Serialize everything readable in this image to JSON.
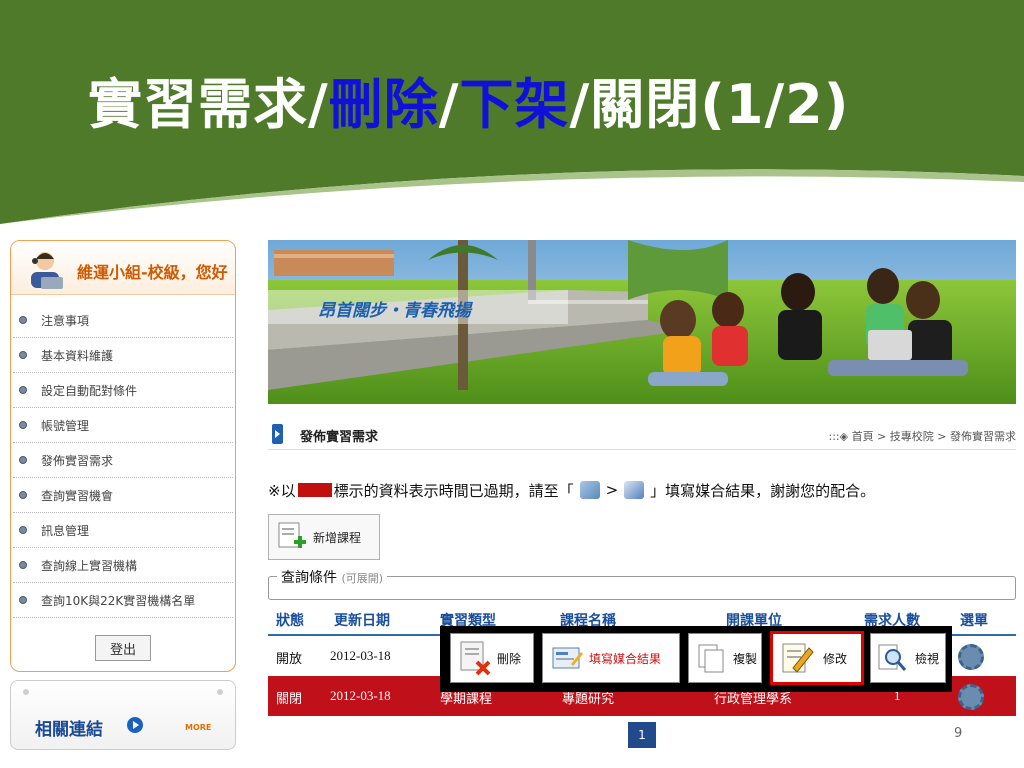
{
  "slide": {
    "title_part1": "實習需求/",
    "title_part2": "刪除",
    "title_sep1": "/",
    "title_part3": "下架",
    "title_part4": "/關閉(1/2)",
    "page_number": "9"
  },
  "sidebar": {
    "user": "維運小組-校級，您好",
    "items": [
      {
        "label": "注意事項"
      },
      {
        "label": "基本資料維護"
      },
      {
        "label": "設定自動配對條件"
      },
      {
        "label": "帳號管理"
      },
      {
        "label": "發佈實習需求"
      },
      {
        "label": "查詢實習機會"
      },
      {
        "label": "訊息管理"
      },
      {
        "label": "查詢線上實習機構"
      },
      {
        "label": "查詢10K與22K實習機構名單"
      }
    ],
    "logout": "登出",
    "links_title": "相關連結",
    "more": "MORE"
  },
  "hero": {
    "slogan": "昂首闊步・青春飛揚"
  },
  "header": {
    "title": "發佈實習需求",
    "breadcrumb": ":::◈ 首頁 > 技專校院 > 發佈實習需求"
  },
  "notice": {
    "prefix": "※以",
    "middle": "標示的資料表示時間已過期，請至「",
    "gt": ">",
    "suffix": "」填寫媒合結果，謝謝您的配合。"
  },
  "toolbar": {
    "add_course": "新增課程"
  },
  "query": {
    "legend": "查詢條件",
    "hint": "(可展開)"
  },
  "table": {
    "columns": [
      "狀態",
      "更新日期",
      "實習類型",
      "課程名稱",
      "開課單位",
      "需求人數",
      "選單"
    ],
    "rows": [
      {
        "status": "開放",
        "date": "2012-03-18",
        "type": "",
        "course": "",
        "unit": "",
        "count": "",
        "expired": false
      },
      {
        "status": "關閉",
        "date": "2012-03-18",
        "type": "學期課程",
        "course": "專題研究",
        "unit": "行政管理學系",
        "count": "1",
        "expired": true
      }
    ]
  },
  "pager": {
    "current": "1"
  },
  "actions": [
    {
      "label": "刪除",
      "icon": "delete-doc-icon"
    },
    {
      "label": "填寫媒合結果",
      "icon": "fill-form-icon"
    },
    {
      "label": "複製",
      "icon": "copy-icon"
    },
    {
      "label": "修改",
      "icon": "edit-icon",
      "selected": true
    },
    {
      "label": "檢視",
      "icon": "magnifier-icon"
    }
  ],
  "colors": {
    "banner_green": "#4f7a2a",
    "highlight_blue": "#1010d8",
    "expired_red": "#c0101a",
    "header_blue": "#1a4f9c",
    "sidebar_orange": "#f0a050"
  }
}
